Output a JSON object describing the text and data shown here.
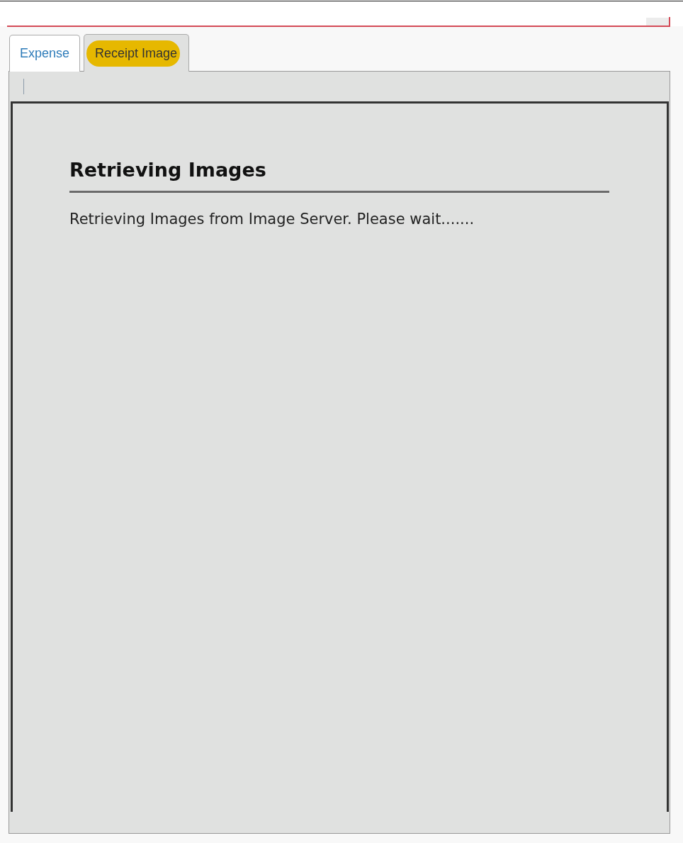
{
  "tabs": [
    {
      "label": "Expense",
      "selected": false
    },
    {
      "label": "Receipt Image",
      "selected": true
    }
  ],
  "content": {
    "heading": "Retrieving Images",
    "message": "Retrieving Images from Image Server. Please wait......."
  }
}
